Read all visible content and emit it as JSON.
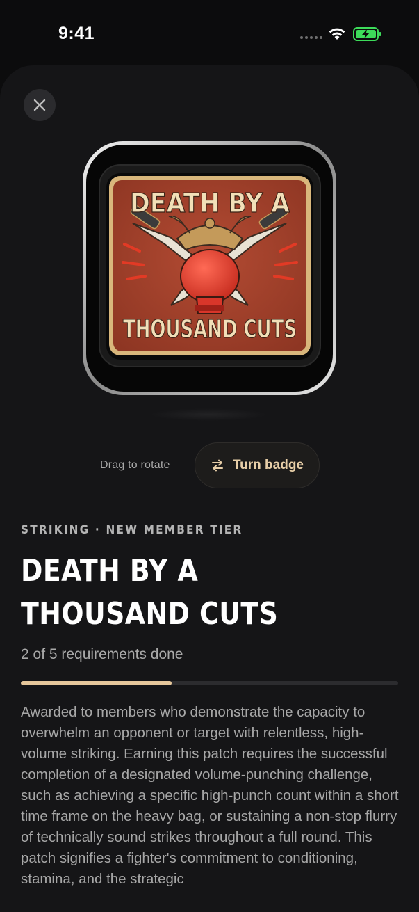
{
  "status_bar": {
    "time": "9:41"
  },
  "badge": {
    "top_text": "DEATH BY A",
    "bottom_text": "THOUSAND CUTS",
    "colors": {
      "patch_fill": "#a5412c",
      "patch_border": "#d9b77c",
      "frame": "#050505",
      "rim": "#c8c8c8",
      "glove": "#e03a2a",
      "helmet": "#c49a5a"
    }
  },
  "controls": {
    "drag_hint": "Drag to rotate",
    "turn_button_label": "Turn badge"
  },
  "details": {
    "tier": "STRIKING · NEW MEMBER TIER",
    "title": "DEATH BY A THOUSAND CUTS",
    "requirements_text": "2 of 5 requirements done",
    "progress": {
      "completed": 2,
      "total": 5
    },
    "description": "Awarded to members who demonstrate the capacity to overwhelm an opponent or target with relentless, high-volume striking. Earning this patch requires the successful completion of a designated volume-punching challenge, such as achieving a specific high-punch count within a short time frame on the heavy bag, or sustaining a non-stop flurry of technically sound strikes throughout a full round. This patch signifies a fighter's commitment to conditioning, stamina, and the strategic"
  },
  "theme": {
    "accent": "#e6c79b",
    "background": "#0c0c0d",
    "sheet": "#151517"
  }
}
